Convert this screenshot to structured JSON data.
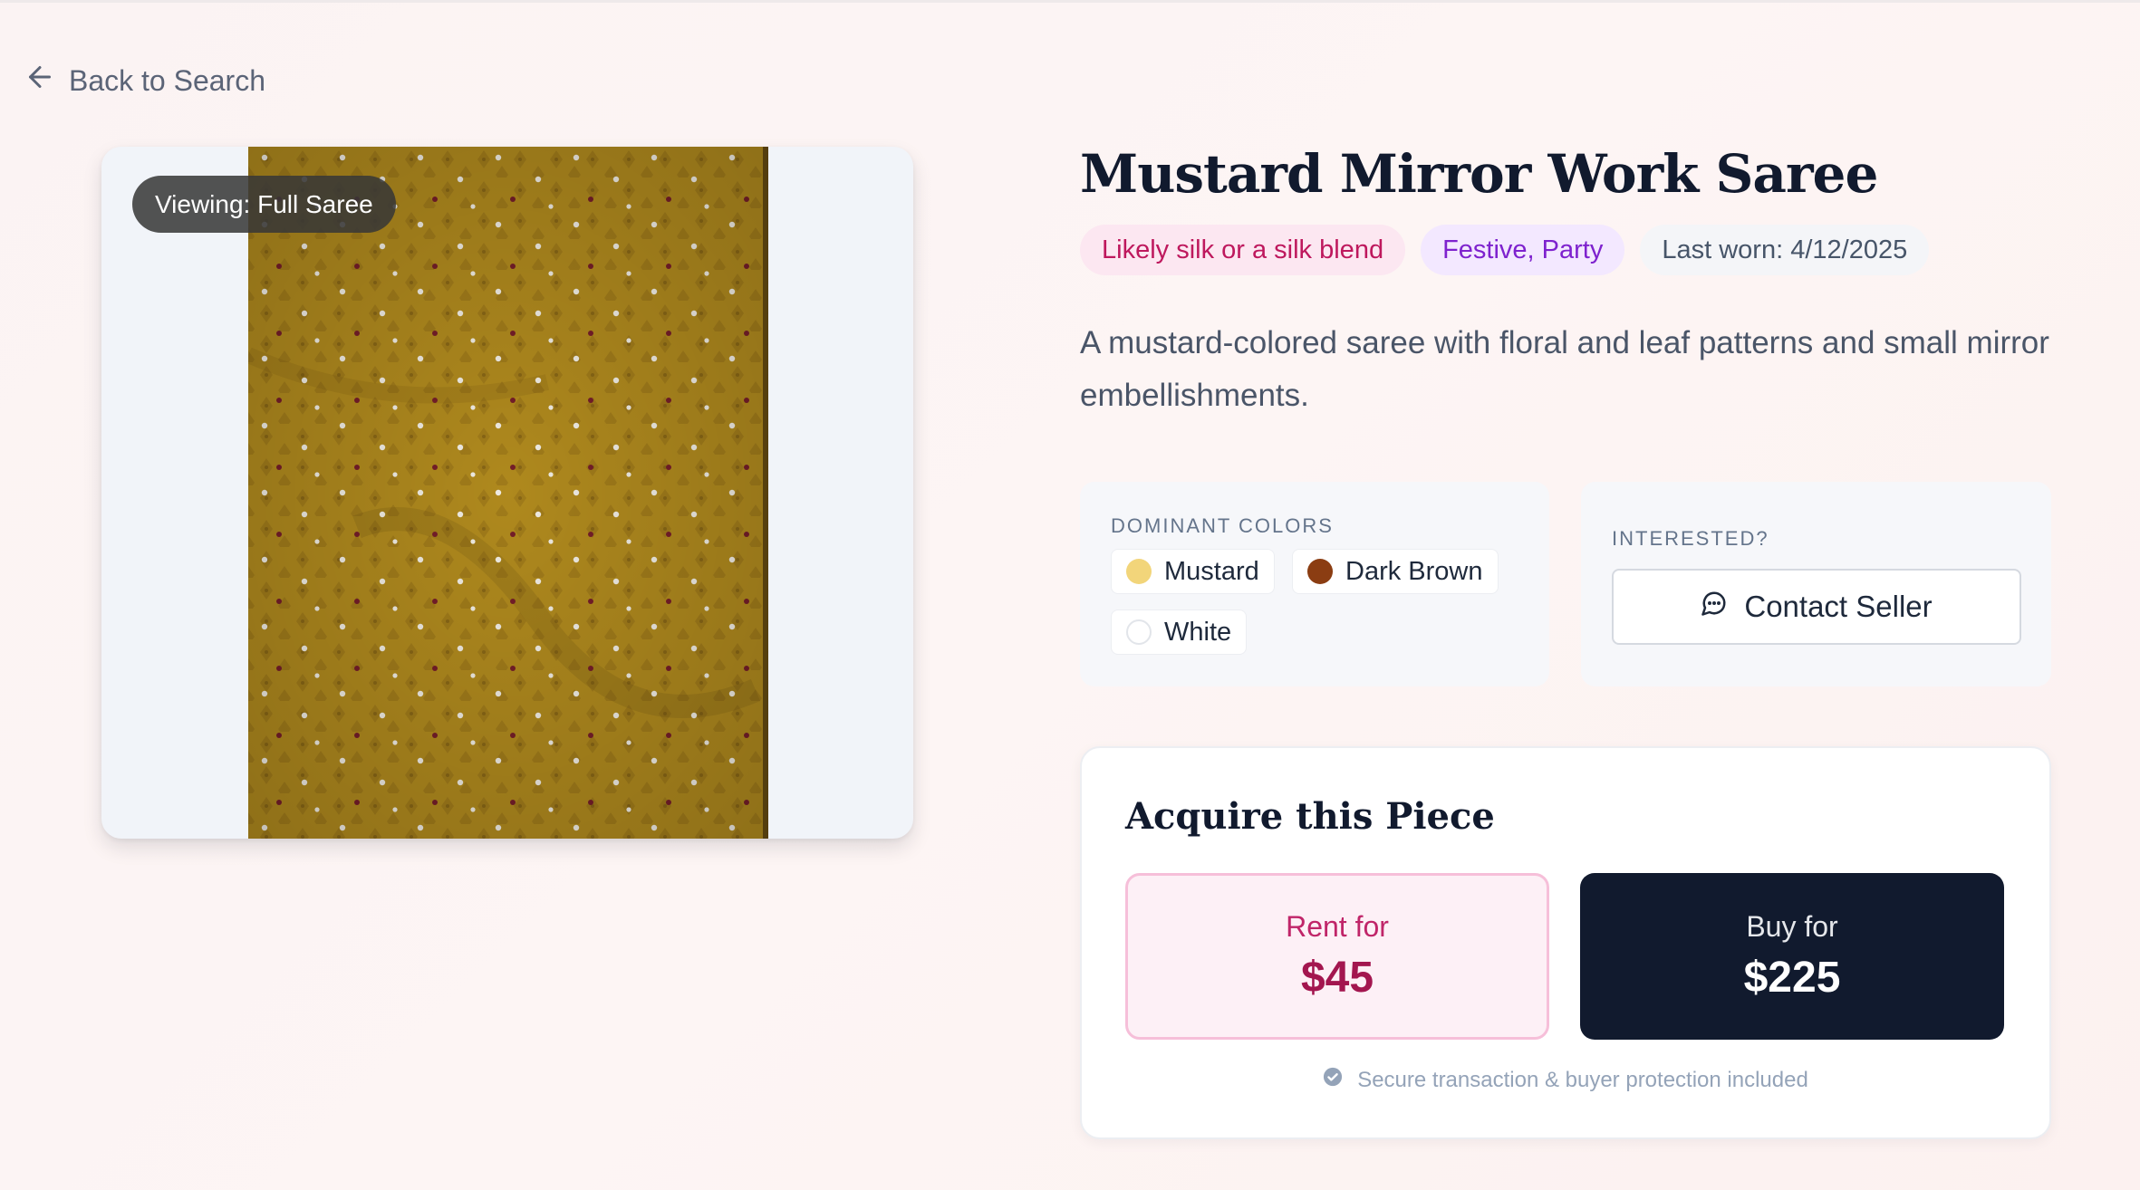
{
  "nav": {
    "back_label": "Back to Search"
  },
  "image": {
    "view_label": "Viewing: Full Saree"
  },
  "product": {
    "title": "Mustard Mirror Work Saree",
    "tags": {
      "material": "Likely silk or a silk blend",
      "occasion": "Festive, Party",
      "last_worn": "Last worn: 4/12/2025"
    },
    "description": "A mustard-colored saree with floral and leaf patterns and small mirror embellishments."
  },
  "colors": {
    "heading": "DOMINANT COLORS",
    "items": [
      {
        "name": "Mustard",
        "hex": "#f2d57a"
      },
      {
        "name": "Dark Brown",
        "hex": "#8b3d12"
      },
      {
        "name": "White",
        "hex": "#ffffff"
      }
    ]
  },
  "interest": {
    "heading": "INTERESTED?",
    "contact_label": "Contact Seller",
    "icon": "message-bubble-icon"
  },
  "acquire": {
    "heading": "Acquire this Piece",
    "rent": {
      "label": "Rent for",
      "price": "$45"
    },
    "buy": {
      "label": "Buy for",
      "price": "$225"
    },
    "secure_note": "Secure transaction & buyer protection included"
  }
}
